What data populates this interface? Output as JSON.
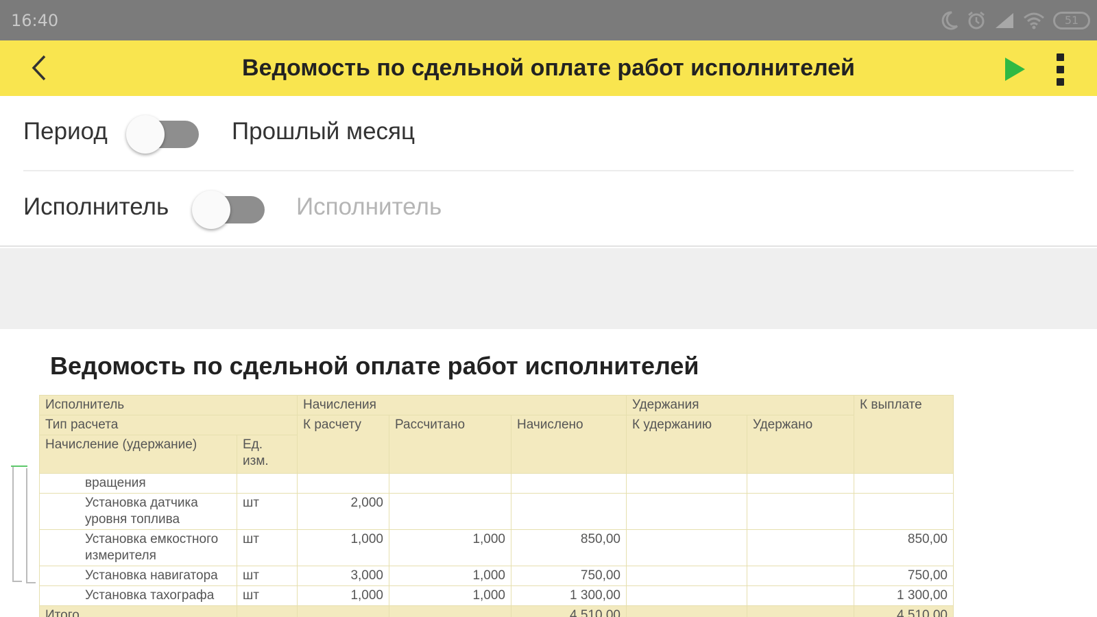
{
  "status_bar": {
    "time": "16:40",
    "battery": "51",
    "icons": [
      "moon-icon",
      "alarm-icon",
      "signal-icon",
      "wifi-icon",
      "battery-icon"
    ]
  },
  "app_bar": {
    "title": "Ведомость по сдельной оплате работ исполнителей",
    "back_icon": "chevron-left-icon",
    "run_icon": "play-icon",
    "menu_icon": "more-vertical-icon",
    "accent_color": "#f9e54f",
    "run_color": "#2fb943"
  },
  "filters": {
    "period": {
      "label": "Период",
      "value": "Прошлый месяц",
      "enabled": false
    },
    "performer": {
      "label": "Исполнитель",
      "placeholder": "Исполнитель",
      "enabled": false
    }
  },
  "report": {
    "title": "Ведомость по сдельной оплате работ исполнителей",
    "header": {
      "performer": "Исполнитель",
      "calc_type": "Тип расчета",
      "accrual_deduction": "Начисление (удержание)",
      "unit": "Ед. изм.",
      "accruals": "Начисления",
      "to_calc": "К расчету",
      "calculated": "Рассчитано",
      "accrued": "Начислено",
      "deductions": "Удержания",
      "to_deduct": "К удержанию",
      "deducted": "Удержано",
      "to_pay": "К выплате"
    },
    "rows": [
      {
        "name": "вращения",
        "unit": "",
        "to_calc": "",
        "calculated": "",
        "accrued": "",
        "to_deduct": "",
        "deducted": "",
        "to_pay": ""
      },
      {
        "name": "Установка датчика уровня топлива",
        "unit": "шт",
        "to_calc": "2,000",
        "calculated": "",
        "accrued": "",
        "to_deduct": "",
        "deducted": "",
        "to_pay": ""
      },
      {
        "name": "Установка емкостного измерителя",
        "unit": "шт",
        "to_calc": "1,000",
        "calculated": "1,000",
        "accrued": "850,00",
        "to_deduct": "",
        "deducted": "",
        "to_pay": "850,00"
      },
      {
        "name": "Установка навигатора",
        "unit": "шт",
        "to_calc": "3,000",
        "calculated": "1,000",
        "accrued": "750,00",
        "to_deduct": "",
        "deducted": "",
        "to_pay": "750,00"
      },
      {
        "name": "Установка тахографа",
        "unit": "шт",
        "to_calc": "1,000",
        "calculated": "1,000",
        "accrued": "1 300,00",
        "to_deduct": "",
        "deducted": "",
        "to_pay": "1 300,00"
      }
    ],
    "total": {
      "label": "Итого",
      "accrued": "4 510,00",
      "to_pay": "4 510,00"
    }
  }
}
